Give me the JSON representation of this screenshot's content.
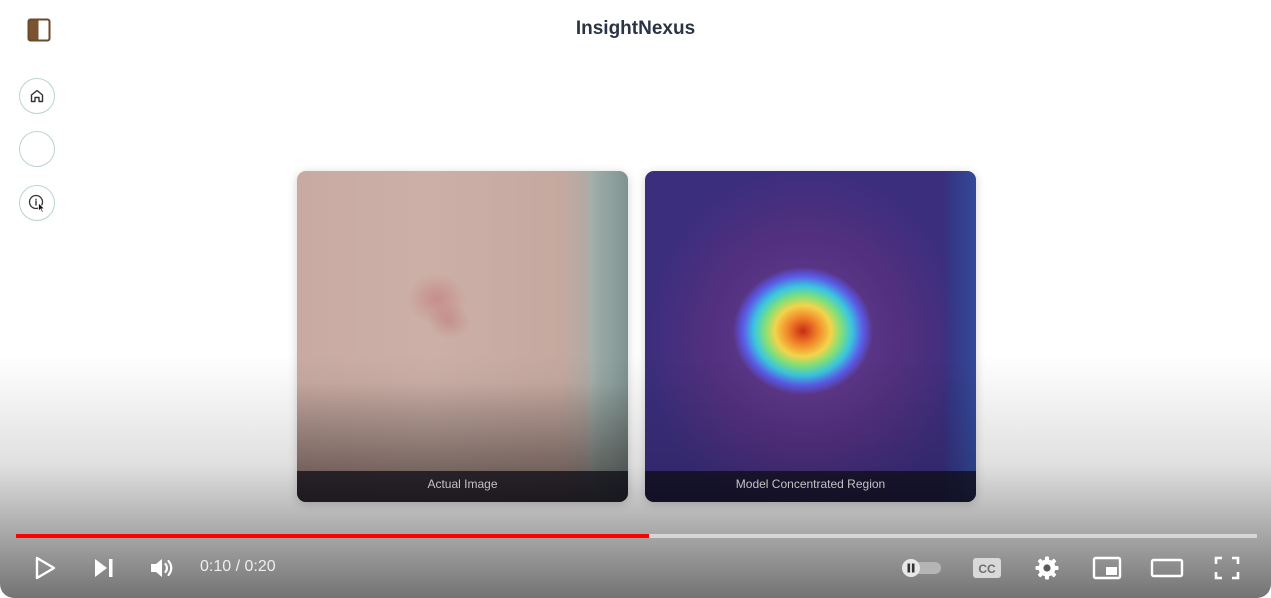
{
  "app": {
    "title": "InsightNexus"
  },
  "nav": {
    "items": [
      {
        "name": "home",
        "icon": "home-icon"
      },
      {
        "name": "blank",
        "icon": ""
      },
      {
        "name": "info",
        "icon": "info-icon"
      }
    ]
  },
  "images": {
    "actual_caption": "Actual Image",
    "model_caption": "Model Concentrated Region"
  },
  "player": {
    "current_time": "0:10",
    "separator": " / ",
    "duration": "0:20",
    "progress": 0.51,
    "accent_color": "#ff0000"
  }
}
